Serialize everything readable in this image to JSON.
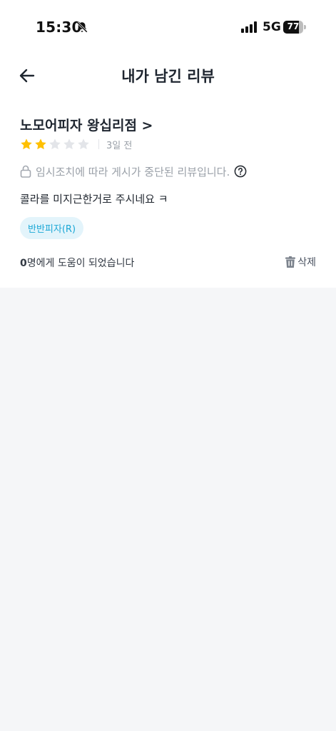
{
  "status_bar": {
    "time": "15:30",
    "network": "5G",
    "battery": "77",
    "battery_level": 0.77,
    "icons": [
      "bell-off-icon",
      "signal-icon",
      "battery-icon"
    ]
  },
  "header": {
    "title": "내가 남긴 리뷰",
    "back_icon": "arrow-left-icon"
  },
  "review": {
    "store_name": "노모어피자 왕십리점 >",
    "rating": 2,
    "max_rating": 5,
    "date": "3일 전",
    "notice": "임시조치에 따라 게시가 중단된 리뷰입니다.",
    "text": "콜라를 미지근한거로 주시네요 ㅋ",
    "menu_tag": "반반피자(R)",
    "helpful_count": "0",
    "helpful_suffix": "명에게 도움이 되었습니다",
    "delete_label": "삭제"
  },
  "colors": {
    "star_active": "#ffc000",
    "star_inactive": "#e3e5e9",
    "tag_bg": "#e3f4fb",
    "tag_text": "#1aa7d6",
    "page_bg": "#f5f6f8"
  }
}
